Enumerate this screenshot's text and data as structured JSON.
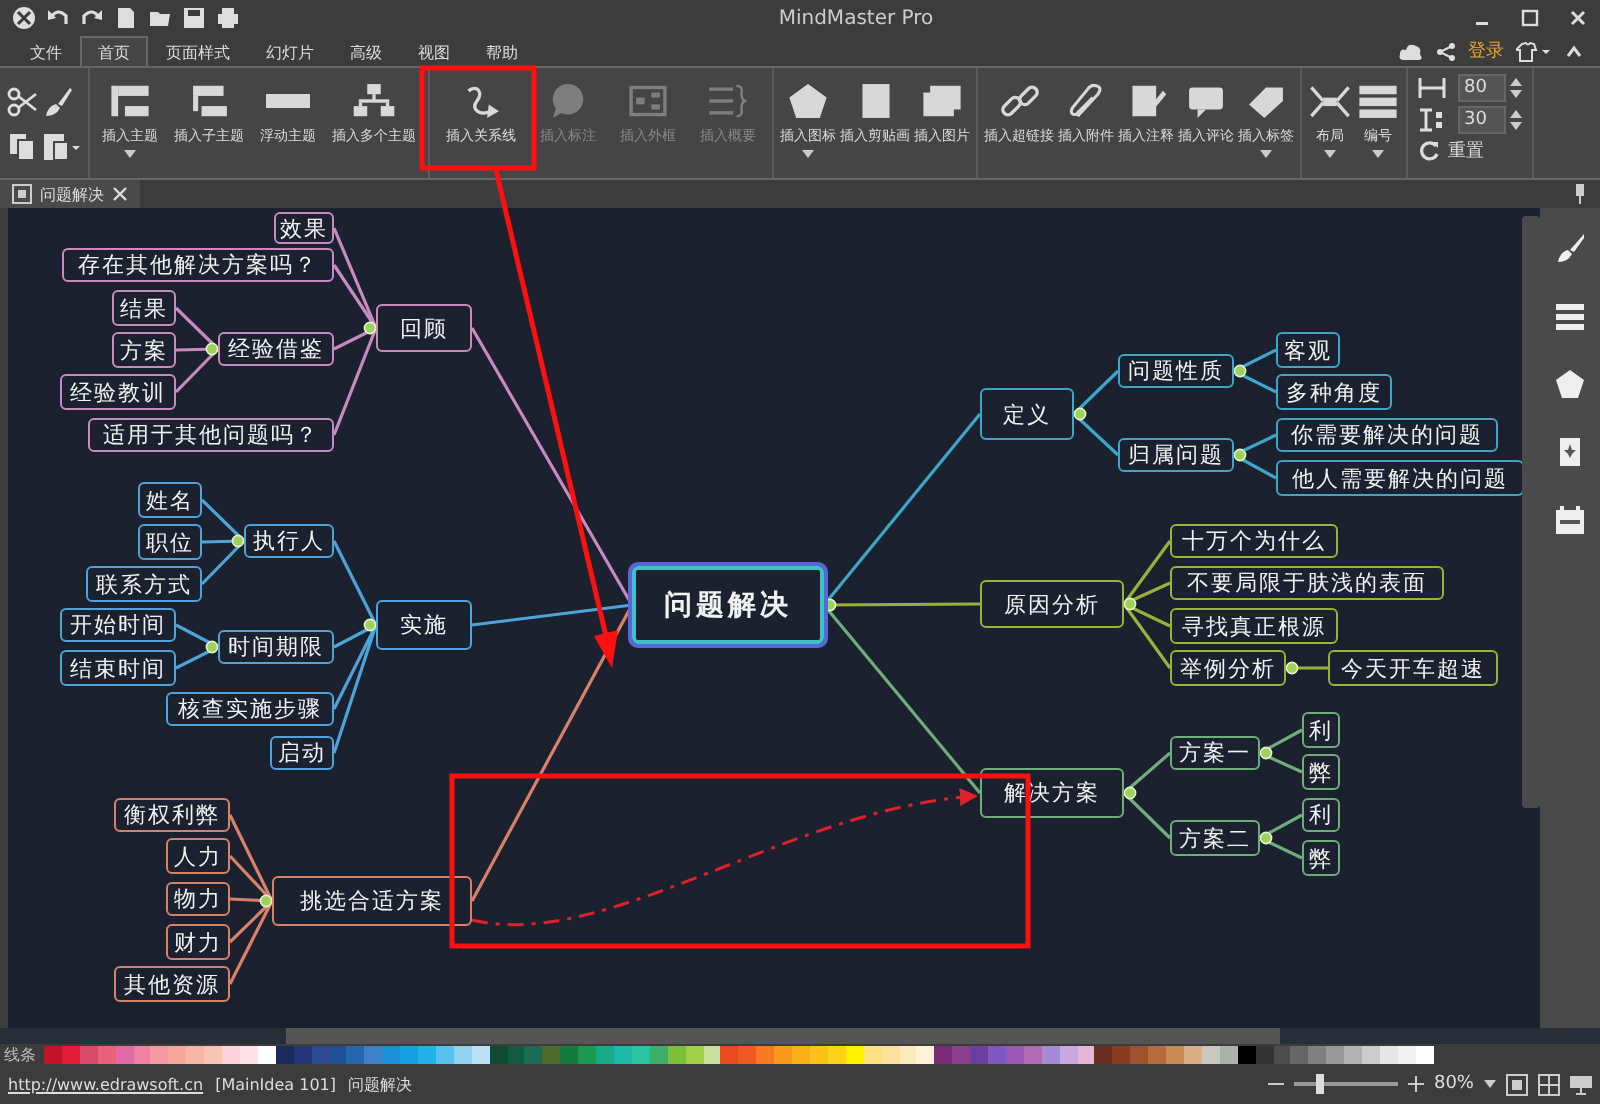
{
  "window": {
    "title": "MindMaster Pro"
  },
  "menu_tabs": [
    {
      "label": "文件",
      "selected": false
    },
    {
      "label": "首页",
      "selected": true
    },
    {
      "label": "页面样式",
      "selected": false
    },
    {
      "label": "幻灯片",
      "selected": false
    },
    {
      "label": "高级",
      "selected": false
    },
    {
      "label": "视图",
      "selected": false
    },
    {
      "label": "帮助",
      "selected": false
    }
  ],
  "account": {
    "login": "登录"
  },
  "ribbon": {
    "groups": [
      [
        {
          "label": "插入主题",
          "disabled": false,
          "dropdown": true
        },
        {
          "label": "插入子主题",
          "disabled": false,
          "dropdown": false
        },
        {
          "label": "浮动主题",
          "disabled": false,
          "dropdown": false
        },
        {
          "label": "插入多个主题",
          "disabled": false,
          "dropdown": false
        }
      ],
      [
        {
          "label": "插入关系线",
          "disabled": false,
          "dropdown": false
        },
        {
          "label": "插入标注",
          "disabled": true,
          "dropdown": false
        },
        {
          "label": "插入外框",
          "disabled": true,
          "dropdown": false
        },
        {
          "label": "插入概要",
          "disabled": true,
          "dropdown": false
        }
      ],
      [
        {
          "label": "插入图标",
          "disabled": false,
          "dropdown": true
        },
        {
          "label": "插入剪贴画",
          "disabled": false,
          "dropdown": false
        },
        {
          "label": "插入图片",
          "disabled": false,
          "dropdown": false
        }
      ],
      [
        {
          "label": "插入超链接",
          "disabled": false,
          "dropdown": false
        },
        {
          "label": "插入附件",
          "disabled": false,
          "dropdown": false
        },
        {
          "label": "插入注释",
          "disabled": false,
          "dropdown": false
        },
        {
          "label": "插入评论",
          "disabled": false,
          "dropdown": false
        },
        {
          "label": "插入标签",
          "disabled": false,
          "dropdown": true
        }
      ],
      [
        {
          "label": "布局",
          "disabled": false,
          "dropdown": true
        },
        {
          "label": "编号",
          "disabled": false,
          "dropdown": true
        }
      ]
    ],
    "spacing": [
      {
        "value": "80"
      },
      {
        "value": "30"
      }
    ],
    "reset": "重置"
  },
  "doc_tab": {
    "title": "问题解决"
  },
  "mind_map": {
    "root": "问题解决",
    "branches": [
      {
        "text": "回顾",
        "color": "#c98bbf",
        "children": [
          {
            "text": "效果"
          },
          {
            "text": "存在其他解决方案吗？"
          },
          {
            "text": "经验借鉴",
            "children": [
              {
                "text": "结果"
              },
              {
                "text": "方案"
              },
              {
                "text": "经验教训"
              }
            ]
          },
          {
            "text": "适用于其他问题吗？"
          }
        ]
      },
      {
        "text": "实施",
        "color": "#4ea3d8",
        "children": [
          {
            "text": "执行人",
            "children": [
              {
                "text": "姓名"
              },
              {
                "text": "职位"
              },
              {
                "text": "联系方式"
              }
            ]
          },
          {
            "text": "时间期限",
            "children": [
              {
                "text": "开始时间"
              },
              {
                "text": "结束时间"
              }
            ]
          },
          {
            "text": "核查实施步骤"
          },
          {
            "text": "启动"
          }
        ]
      },
      {
        "text": "挑选合适方案",
        "color": "#d9826b",
        "children": [
          {
            "text": "衡权利弊"
          },
          {
            "text": "人力"
          },
          {
            "text": "物力"
          },
          {
            "text": "财力"
          },
          {
            "text": "其他资源"
          }
        ]
      },
      {
        "text": "定义",
        "color": "#3ea6c8",
        "children": [
          {
            "text": "问题性质",
            "children": [
              {
                "text": "客观"
              },
              {
                "text": "多种角度"
              }
            ]
          },
          {
            "text": "归属问题",
            "children": [
              {
                "text": "你需要解决的问题"
              },
              {
                "text": "他人需要解决的问题"
              }
            ]
          }
        ]
      },
      {
        "text": "原因分析",
        "color": "#9bb236",
        "children": [
          {
            "text": "十万个为什么"
          },
          {
            "text": "不要局限于肤浅的表面"
          },
          {
            "text": "寻找真正根源"
          },
          {
            "text": "举例分析",
            "children": [
              {
                "text": "今天开车超速"
              }
            ]
          }
        ]
      },
      {
        "text": "解决方案",
        "color": "#6fae7a",
        "children": [
          {
            "text": "方案一",
            "children": [
              {
                "text": "利"
              },
              {
                "text": "弊"
              }
            ]
          },
          {
            "text": "方案二",
            "children": [
              {
                "text": "利"
              },
              {
                "text": "弊"
              }
            ]
          }
        ]
      }
    ]
  },
  "palette": {
    "label": "线条",
    "swatches": [
      {
        "color": "#c0142a"
      },
      {
        "color": "#e01e37"
      },
      {
        "color": "#d84b6b"
      },
      {
        "color": "#e8637a"
      },
      {
        "color": "#e26aa2"
      },
      {
        "color": "#f07fa0"
      },
      {
        "color": "#f59aa0"
      },
      {
        "color": "#f8a89a"
      },
      {
        "color": "#f7b7a3"
      },
      {
        "color": "#f9c6b5"
      },
      {
        "color": "#fbd3de"
      },
      {
        "color": "#fde2ea"
      },
      {
        "color": "#ffffff"
      },
      {
        "color": "#1a2a5c"
      },
      {
        "color": "#25357a"
      },
      {
        "color": "#2b4a8f"
      },
      {
        "color": "#1d4f9a"
      },
      {
        "color": "#2566b0"
      },
      {
        "color": "#3f7fc6"
      },
      {
        "color": "#1b8fd6"
      },
      {
        "color": "#18a0e0"
      },
      {
        "color": "#22b4e8"
      },
      {
        "color": "#56c3ee"
      },
      {
        "color": "#8fd2f0"
      },
      {
        "color": "#b8e4f6"
      },
      {
        "color": "#0f4a34"
      },
      {
        "color": "#135c3e"
      },
      {
        "color": "#1b6b55"
      },
      {
        "color": "#4e6b2e"
      },
      {
        "color": "#137a40"
      },
      {
        "color": "#1a9a50"
      },
      {
        "color": "#19aa8a"
      },
      {
        "color": "#1fb8a6"
      },
      {
        "color": "#2cc4a0"
      },
      {
        "color": "#3cb06a"
      },
      {
        "color": "#7cbf3a"
      },
      {
        "color": "#a3cf4a"
      },
      {
        "color": "#c9e0a0"
      },
      {
        "color": "#e8491d"
      },
      {
        "color": "#f05a22"
      },
      {
        "color": "#f47b20"
      },
      {
        "color": "#f89a1c"
      },
      {
        "color": "#fbb01a"
      },
      {
        "color": "#fcc21a"
      },
      {
        "color": "#ffd21e"
      },
      {
        "color": "#fff200"
      },
      {
        "color": "#fde080"
      },
      {
        "color": "#fbe0a0"
      },
      {
        "color": "#fde9c0"
      },
      {
        "color": "#fff4d8"
      },
      {
        "color": "#7a2a7a"
      },
      {
        "color": "#8e3c8e"
      },
      {
        "color": "#6b3fa0"
      },
      {
        "color": "#7e57c2"
      },
      {
        "color": "#9b59b6"
      },
      {
        "color": "#b06bb0"
      },
      {
        "color": "#a58ad8"
      },
      {
        "color": "#c8a8e0"
      },
      {
        "color": "#e6b6d8"
      },
      {
        "color": "#6b2e1e"
      },
      {
        "color": "#8a3c22"
      },
      {
        "color": "#a0522d"
      },
      {
        "color": "#b86a3c"
      },
      {
        "color": "#c88a54"
      },
      {
        "color": "#d8b088"
      },
      {
        "color": "#c8c8c0"
      },
      {
        "color": "#a8b4a8"
      },
      {
        "color": "#000000"
      },
      {
        "color": "#333333"
      },
      {
        "color": "#4d4d4d"
      },
      {
        "color": "#666666"
      },
      {
        "color": "#808080"
      },
      {
        "color": "#999999"
      },
      {
        "color": "#b3b3b3"
      },
      {
        "color": "#cccccc"
      },
      {
        "color": "#e6e6e6"
      },
      {
        "color": "#f2f2f2"
      },
      {
        "color": "#ffffff"
      }
    ]
  },
  "status_bar": {
    "link": "http://www.edrawsoft.cn",
    "topic_id": "[MainIdea 101]",
    "document": "问题解决",
    "zoom": "80%",
    "zoom_slider": {
      "level": 0.25
    }
  }
}
